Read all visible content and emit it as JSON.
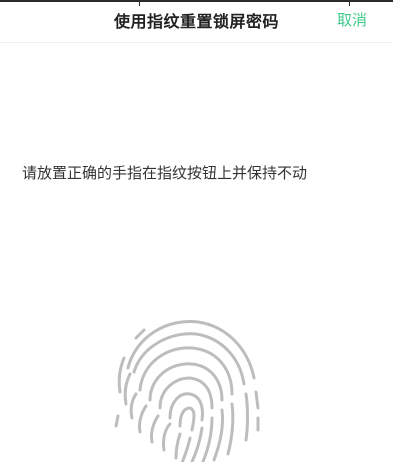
{
  "header": {
    "title": "使用指纹重置锁屏密码",
    "cancel_label": "取消"
  },
  "main": {
    "instruction": "请放置正确的手指在指纹按钮上并保持不动",
    "fingerprint_icon": "fingerprint-icon"
  },
  "colors": {
    "accent": "#3fc98a",
    "title_text": "#222222",
    "body_text": "#333333",
    "icon_stroke": "#bdbdbd"
  }
}
